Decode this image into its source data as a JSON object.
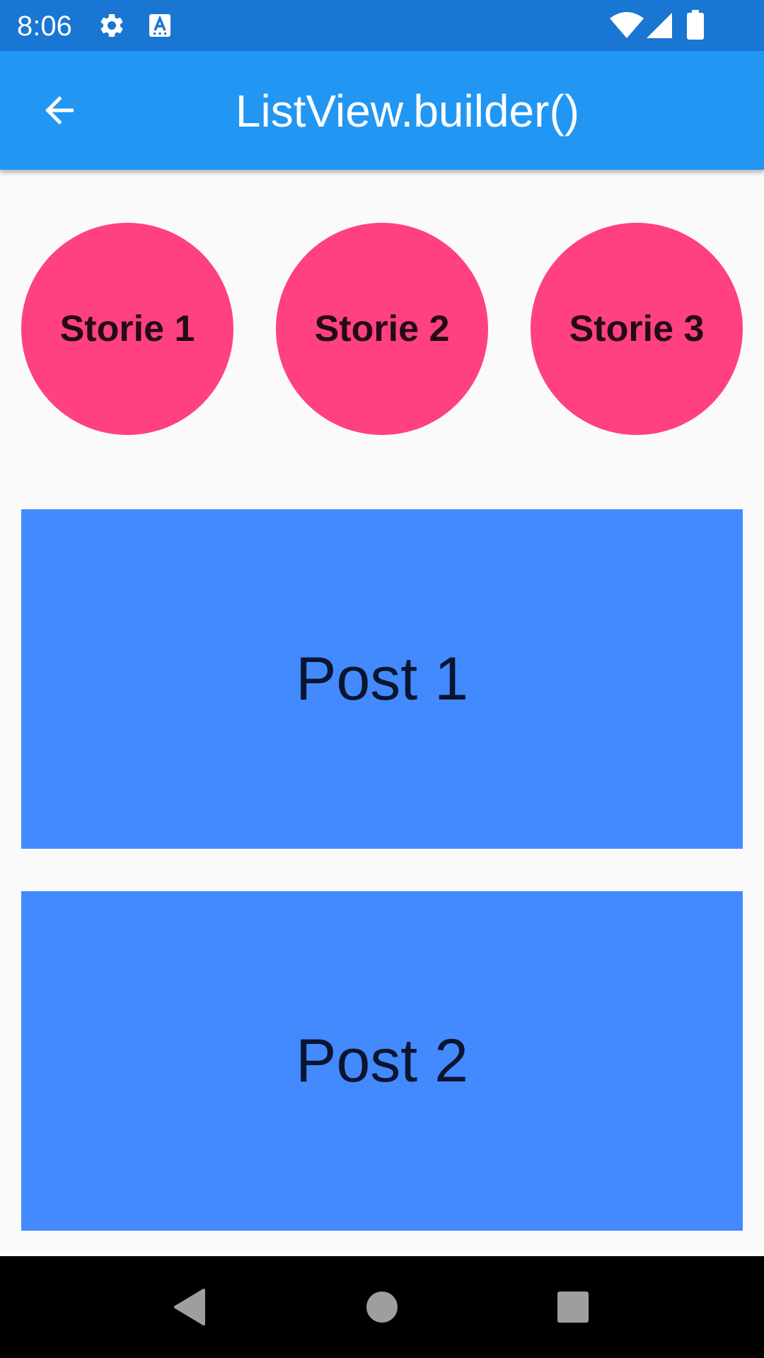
{
  "status_bar": {
    "time": "8:06",
    "left_icons": [
      "gear-icon",
      "keyboard-a-icon"
    ],
    "right_icons": [
      "wifi-icon",
      "cellular-signal-icon",
      "battery-icon"
    ]
  },
  "app_bar": {
    "title": "ListView.builder()",
    "back_icon": "arrow-back-icon"
  },
  "stories": [
    {
      "label": "Storie 1"
    },
    {
      "label": "Storie 2"
    },
    {
      "label": "Storie 3"
    }
  ],
  "posts": [
    {
      "label": "Post 1"
    },
    {
      "label": "Post 2"
    }
  ],
  "nav_bar": {
    "buttons": [
      "back-triangle-icon",
      "home-circle-icon",
      "recents-square-icon"
    ]
  },
  "colors": {
    "status_bar": "#1976d2",
    "app_bar": "#2196f3",
    "story": "#ff4081",
    "post": "#448aff",
    "background": "#fafafa",
    "nav_bar": "#000000"
  }
}
